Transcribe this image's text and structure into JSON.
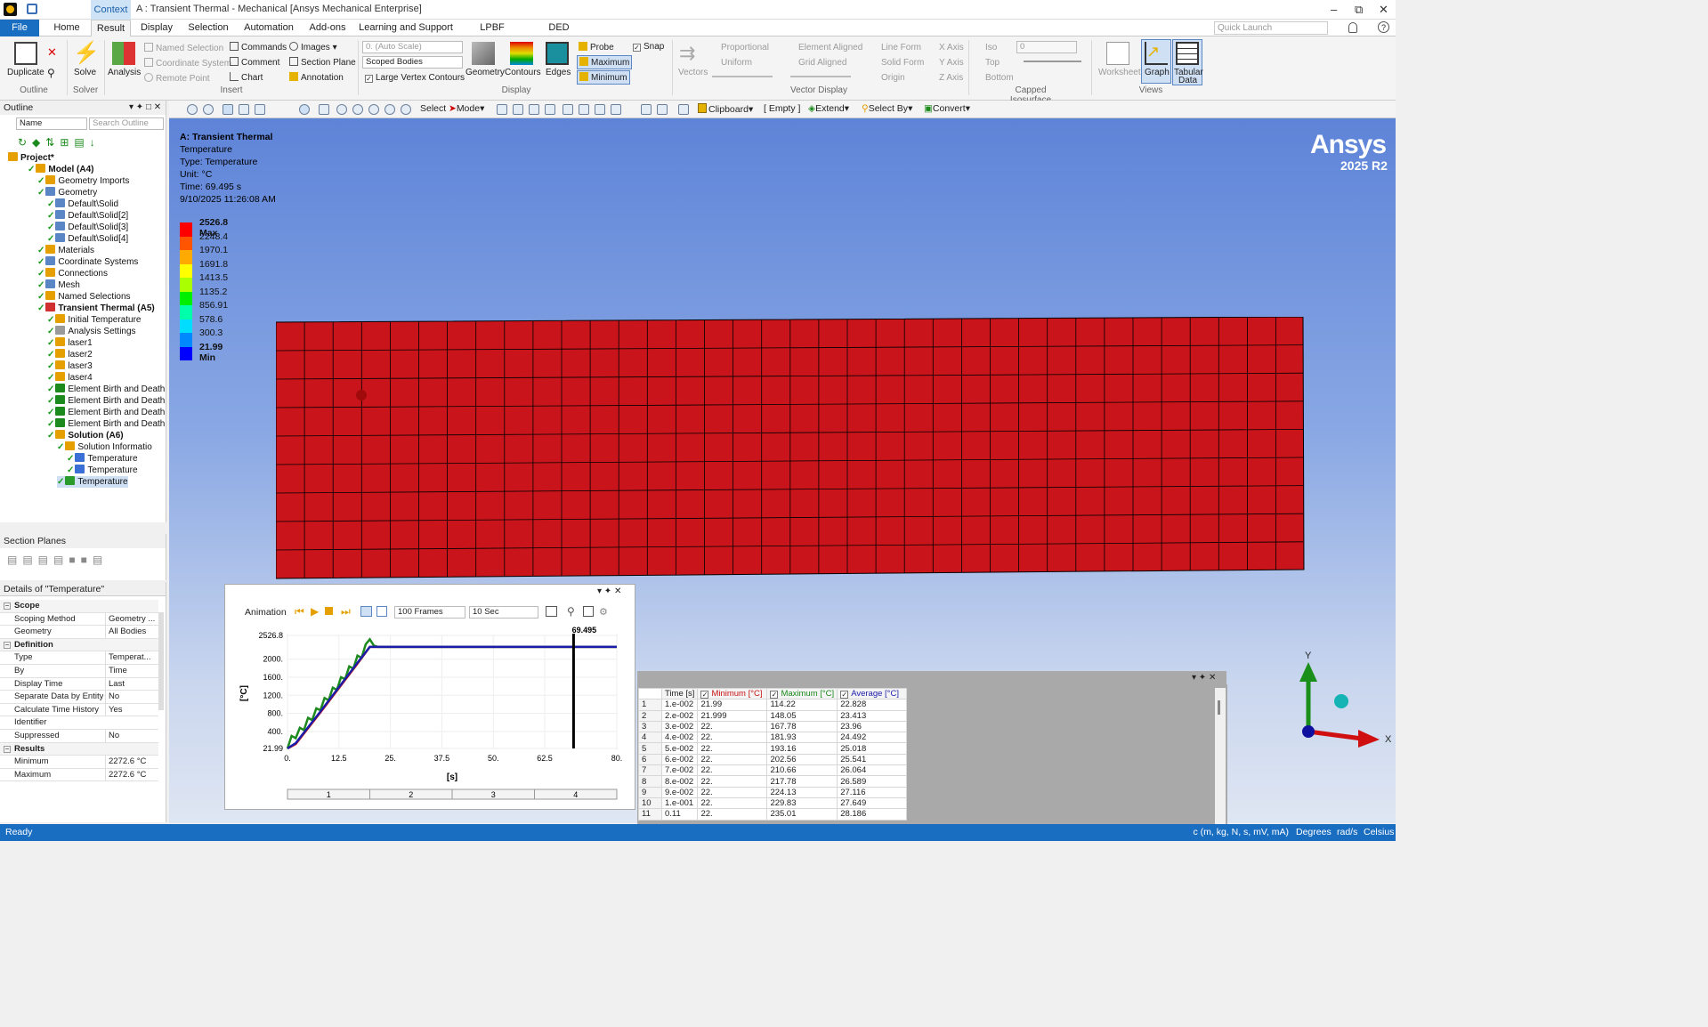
{
  "title_bar": {
    "context": "Context",
    "title": "A : Transient Thermal - Mechanical [Ansys Mechanical Enterprise]"
  },
  "tabs": [
    "File",
    "Home",
    "Result",
    "Display",
    "Selection",
    "Automation",
    "Add-ons",
    "Learning and Support",
    "LPBF Process",
    "DED Process"
  ],
  "quick_launch": "Quick Launch",
  "ribbon": {
    "duplicate": "Duplicate",
    "outline_grp": "Outline",
    "solve": "Solve",
    "solver_grp": "Solver",
    "analysis": "Analysis",
    "named_selection": "Named Selection",
    "coordinate_system": "Coordinate System",
    "remote_point": "Remote Point",
    "commands": "Commands",
    "comment": "Comment",
    "chart": "Chart",
    "images": "Images",
    "section_plane": "Section Plane",
    "annotation": "Annotation",
    "insert_grp": "Insert",
    "scale": "0. (Auto Scale)",
    "scoped_bodies": "Scoped Bodies",
    "large_vertex": "Large Vertex Contours",
    "geometry": "Geometry",
    "contours": "Contours",
    "edges": "Edges",
    "display_grp": "Display",
    "probe": "Probe",
    "maximum": "Maximum",
    "minimum": "Minimum",
    "snap": "Snap",
    "vectors": "Vectors",
    "proportional": "Proportional",
    "uniform": "Uniform",
    "element_aligned": "Element Aligned",
    "grid_aligned": "Grid Aligned",
    "line_form": "Line Form",
    "solid_form": "Solid Form",
    "origin": "Origin",
    "x_axis": "X Axis",
    "y_axis": "Y Axis",
    "z_axis": "Z Axis",
    "vector_display_grp": "Vector Display",
    "iso": "Iso",
    "top": "Top",
    "bottom": "Bottom",
    "iso_value": "0",
    "capped_grp": "Capped Isosurface",
    "worksheet": "Worksheet",
    "graph": "Graph",
    "tabular": "Tabular",
    "data": "Data",
    "views_grp": "Views"
  },
  "toolbar": {
    "select": "Select",
    "mode": "Mode",
    "clipboard": "Clipboard",
    "empty": "[ Empty ]",
    "extend": "Extend",
    "select_by": "Select By",
    "convert": "Convert"
  },
  "outline": {
    "title": "Outline",
    "name_filter": "Name",
    "search": "Search Outline",
    "items": [
      "Project*",
      "Model (A4)",
      "Geometry Imports",
      "Geometry",
      "Default\\Solid",
      "Default\\Solid[2]",
      "Default\\Solid[3]",
      "Default\\Solid[4]",
      "Materials",
      "Coordinate Systems",
      "Connections",
      "Mesh",
      "Named Selections",
      "Transient Thermal (A5)",
      "Initial Temperature",
      "Analysis Settings",
      "laser1",
      "laser2",
      "laser3",
      "laser4",
      "Element Birth and Death",
      "Element Birth and Death",
      "Element Birth and Death",
      "Element Birth and Death",
      "Solution (A6)",
      "Solution Informatio",
      "Temperature",
      "Temperature",
      "Temperature"
    ]
  },
  "section_planes": {
    "title": "Section Planes"
  },
  "details": {
    "title": "Details of \"Temperature\"",
    "rows": [
      {
        "k": "Scope",
        "v": "",
        "sec": true
      },
      {
        "k": "Scoping Method",
        "v": "Geometry ..."
      },
      {
        "k": "Geometry",
        "v": "All Bodies"
      },
      {
        "k": "Definition",
        "v": "",
        "sec": true
      },
      {
        "k": "Type",
        "v": "Temperat..."
      },
      {
        "k": "By",
        "v": "Time"
      },
      {
        "k": "Display Time",
        "v": "Last"
      },
      {
        "k": "Separate Data by Entity",
        "v": "No"
      },
      {
        "k": "Calculate Time History",
        "v": "Yes"
      },
      {
        "k": "Identifier",
        "v": ""
      },
      {
        "k": "Suppressed",
        "v": "No"
      },
      {
        "k": "Results",
        "v": "",
        "sec": true
      },
      {
        "k": "Minimum",
        "v": "2272.6 °C"
      },
      {
        "k": "Maximum",
        "v": "2272.6 °C"
      }
    ]
  },
  "viewport": {
    "analysis": "A: Transient Thermal",
    "result": "Temperature",
    "type": "Type: Temperature",
    "unit": "Unit: °C",
    "time": "Time: 69.495 s",
    "date": "9/10/2025 11:26:08 AM",
    "brand": "Ansys",
    "version": "2025 R2",
    "legend": [
      "2526.8 Max",
      "2248.4",
      "1970.1",
      "1691.8",
      "1413.5",
      "1135.2",
      "856.91",
      "578.6",
      "300.3",
      "21.99 Min"
    ],
    "legend_colors": [
      "#ff0000",
      "#ff5500",
      "#ffaa00",
      "#ffff00",
      "#aaff00",
      "#00ee00",
      "#00ffaa",
      "#00ddff",
      "#0088ff",
      "#0000ff"
    ],
    "model_color": "#c8141a",
    "axis_y": "Y",
    "axis_x": "X"
  },
  "animation": {
    "label": "Animation",
    "frames": "100 Frames",
    "duration": "10 Sec",
    "time_marker": "69.495",
    "yaxis_label": "[°C]",
    "xaxis_label": "[s]",
    "steps": [
      "1",
      "2",
      "3",
      "4"
    ]
  },
  "chart_data": {
    "type": "line",
    "x_ticks": [
      "0.",
      "12.5",
      "25.",
      "37.5",
      "50.",
      "62.5",
      "80."
    ],
    "y_ticks": [
      "21.99",
      "400.",
      "800.",
      "1200.",
      "1600.",
      "2000.",
      "2526.8"
    ],
    "xlim": [
      0,
      80
    ],
    "ylim": [
      21.99,
      2526.8
    ],
    "current_time": 69.495,
    "series": [
      {
        "name": "Minimum",
        "color": "#c81414",
        "x": [
          0,
          2,
          5,
          8,
          11,
          14,
          17,
          20,
          22,
          80
        ],
        "y": [
          21.99,
          120,
          470,
          820,
          1180,
          1540,
          1900,
          2272.6,
          2272.6,
          2272.6
        ]
      },
      {
        "name": "Maximum",
        "color": "#1c8a1c",
        "x": [
          0,
          1,
          2,
          3,
          4,
          5,
          6,
          7,
          8,
          9,
          10,
          11,
          12,
          13,
          14,
          15,
          16,
          17,
          18,
          19,
          20,
          21,
          22,
          80
        ],
        "y": [
          21.99,
          300,
          250,
          480,
          430,
          700,
          650,
          910,
          870,
          1140,
          1090,
          1370,
          1320,
          1600,
          1560,
          1840,
          1790,
          2080,
          2030,
          2330,
          2440,
          2300,
          2272.6,
          2272.6
        ]
      },
      {
        "name": "Average",
        "color": "#1c1caa",
        "x": [
          0,
          2,
          5,
          8,
          11,
          14,
          17,
          20,
          22,
          80
        ],
        "y": [
          22.83,
          140,
          490,
          840,
          1200,
          1560,
          1920,
          2272.6,
          2272.6,
          2272.6
        ]
      }
    ]
  },
  "table": {
    "headers": [
      "Time [s]",
      "Minimum [°C]",
      "Maximum [°C]",
      "Average [°C]"
    ],
    "rows": [
      [
        "1",
        "1.e-002",
        "21.99",
        "114.22",
        "22.828"
      ],
      [
        "2",
        "2.e-002",
        "21.999",
        "148.05",
        "23.413"
      ],
      [
        "3",
        "3.e-002",
        "22.",
        "167.78",
        "23.96"
      ],
      [
        "4",
        "4.e-002",
        "22.",
        "181.93",
        "24.492"
      ],
      [
        "5",
        "5.e-002",
        "22.",
        "193.16",
        "25.018"
      ],
      [
        "6",
        "6.e-002",
        "22.",
        "202.56",
        "25.541"
      ],
      [
        "7",
        "7.e-002",
        "22.",
        "210.66",
        "26.064"
      ],
      [
        "8",
        "8.e-002",
        "22.",
        "217.78",
        "26.589"
      ],
      [
        "9",
        "9.e-002",
        "22.",
        "224.13",
        "27.116"
      ],
      [
        "10",
        "1.e-001",
        "22.",
        "229.83",
        "27.649"
      ],
      [
        "11",
        "0.11",
        "22.",
        "235.01",
        "28.186"
      ]
    ]
  },
  "status": {
    "ready": "Ready",
    "units": "Metric (m, kg, N, s, mV, mA)",
    "degrees": "Degrees",
    "rads": "rad/s",
    "celsius": "Celsius"
  }
}
